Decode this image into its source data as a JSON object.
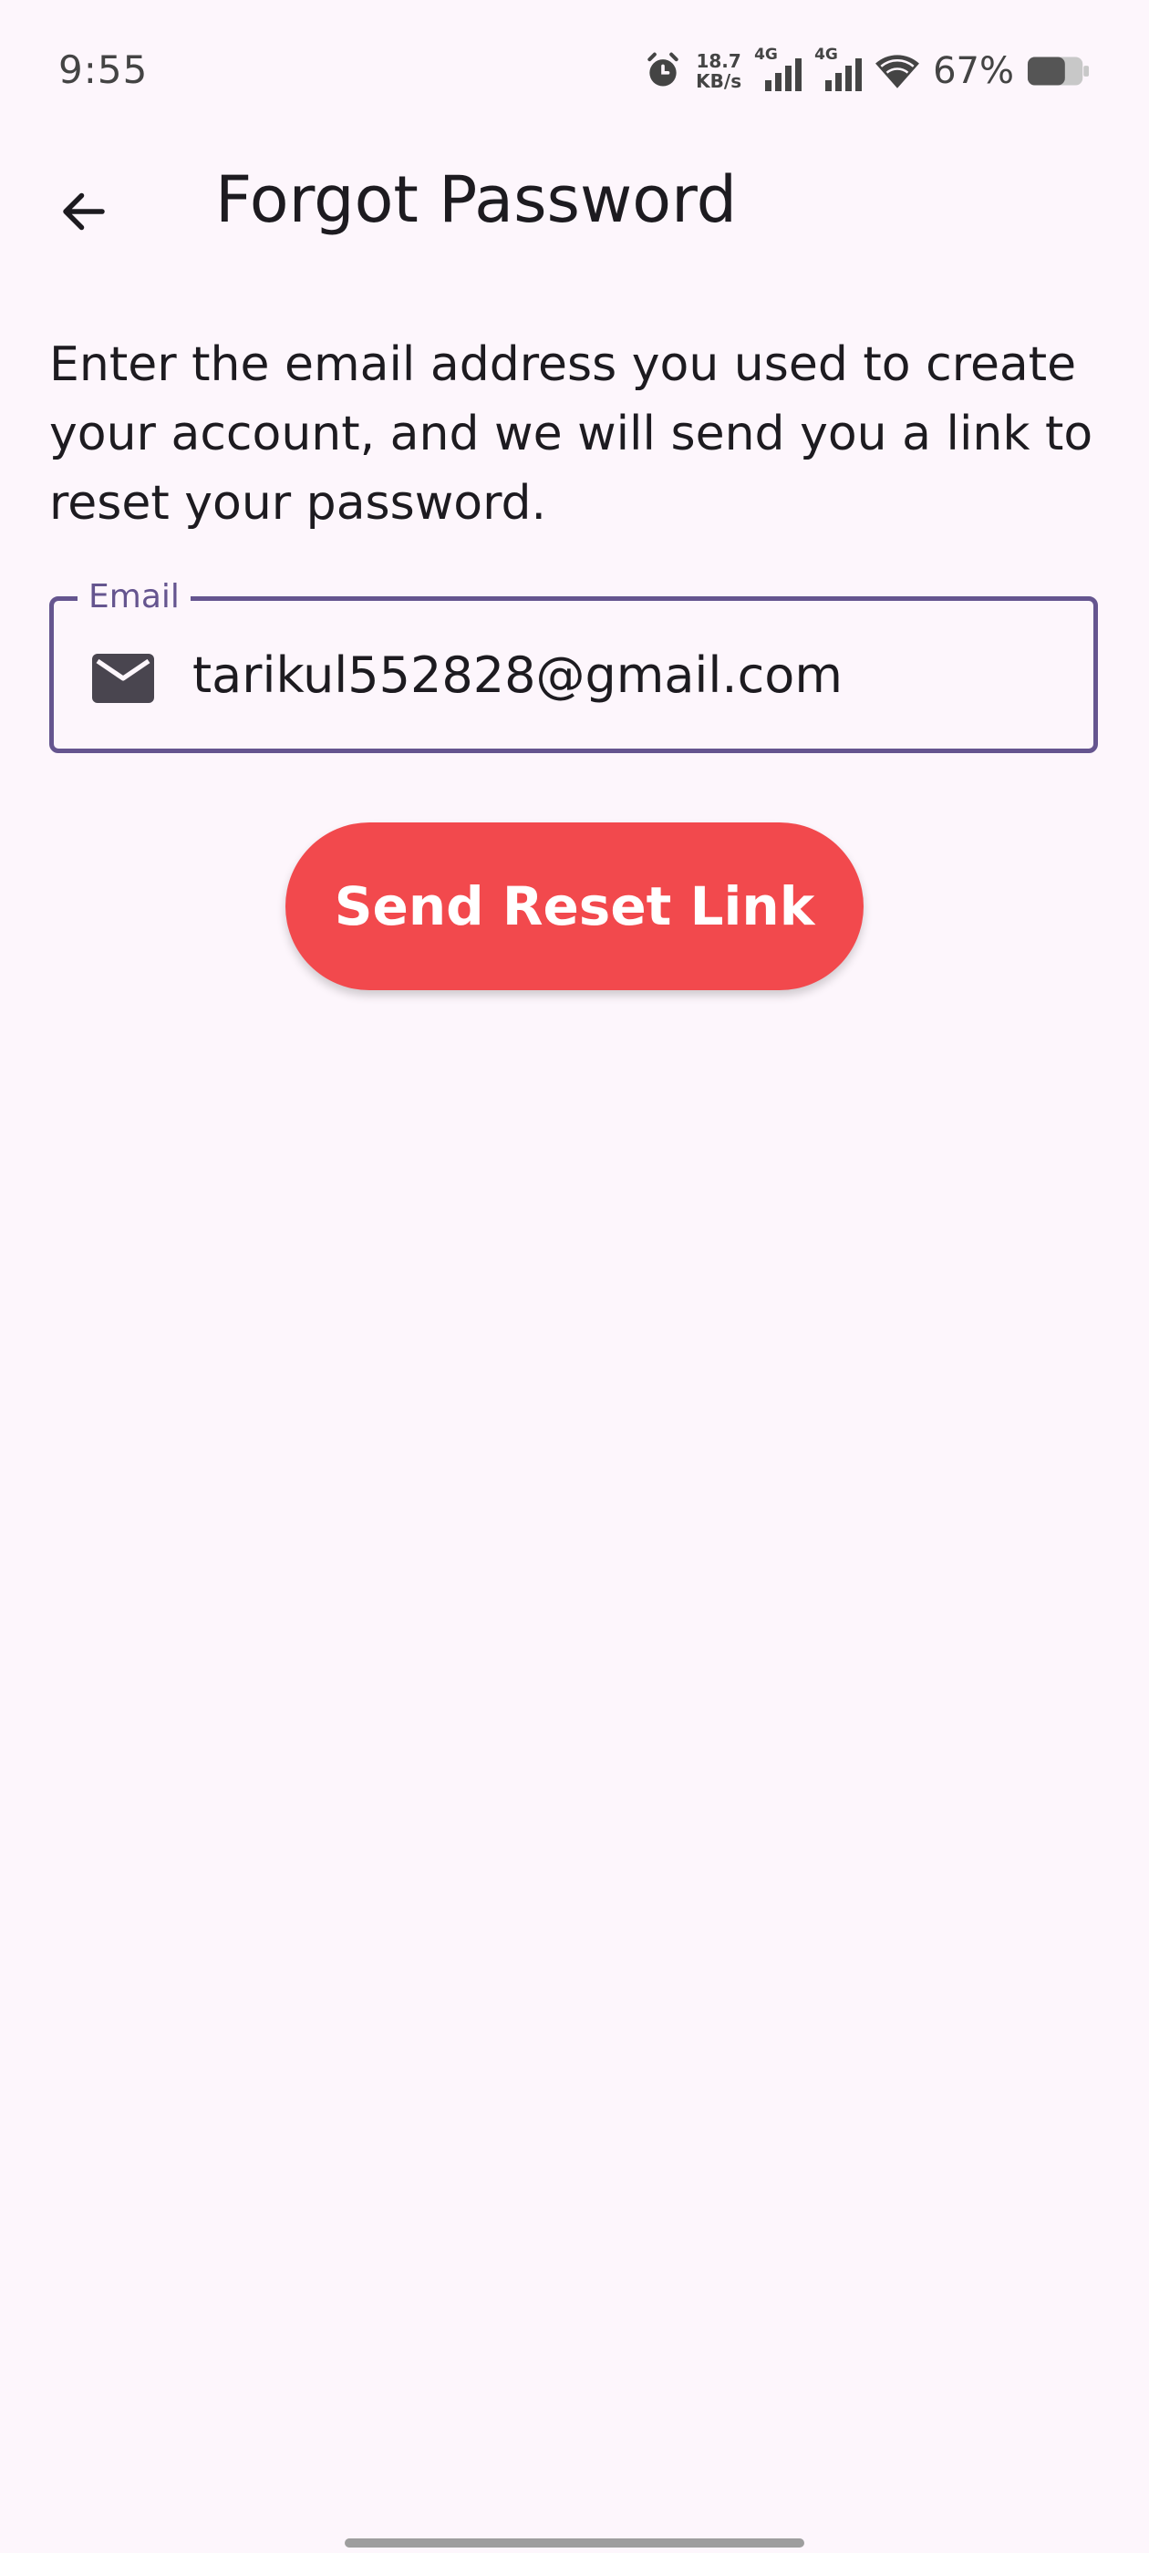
{
  "status_bar": {
    "time": "9:55",
    "net_speed_value": "18.7",
    "net_speed_unit": "KB/s",
    "sim1_tag": "4G",
    "sim2_tag": "4G",
    "battery_percent": "67%",
    "battery_level": 0.67,
    "icons": [
      "alarm-icon",
      "signal-icon",
      "signal-icon",
      "wifi-icon",
      "battery-icon"
    ]
  },
  "app_bar": {
    "title": "Forgot Password",
    "back_icon": "arrow-back-icon"
  },
  "description": "Enter the email address you used to create your account, and we will send you a link to reset your password.",
  "email_field": {
    "label": "Email",
    "value": "tarikul552828@gmail.com",
    "icon": "mail-icon"
  },
  "send_button": {
    "label": "Send Reset Link"
  },
  "colors": {
    "background": "#fdf6fc",
    "accent": "#65558f",
    "button": "#f2494d",
    "text": "#1d1b20"
  }
}
